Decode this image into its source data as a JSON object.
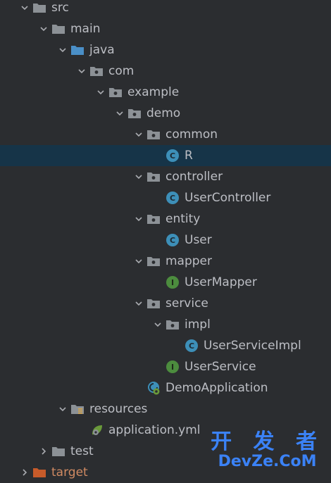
{
  "tree": [
    {
      "label": "src",
      "depth": 0,
      "kind": "folder",
      "arrow": "down",
      "icon": "folder-icon"
    },
    {
      "label": "main",
      "depth": 1,
      "kind": "folder",
      "arrow": "down",
      "icon": "folder-icon"
    },
    {
      "label": "java",
      "depth": 2,
      "kind": "folder",
      "arrow": "down",
      "icon": "source-folder-icon"
    },
    {
      "label": "com",
      "depth": 3,
      "kind": "package",
      "arrow": "down",
      "icon": "package-icon"
    },
    {
      "label": "example",
      "depth": 4,
      "kind": "package",
      "arrow": "down",
      "icon": "package-icon"
    },
    {
      "label": "demo",
      "depth": 5,
      "kind": "package",
      "arrow": "down",
      "icon": "package-icon"
    },
    {
      "label": "common",
      "depth": 6,
      "kind": "package",
      "arrow": "down",
      "icon": "package-icon"
    },
    {
      "label": "R",
      "depth": 7,
      "kind": "class",
      "arrow": "none",
      "icon": "class-icon",
      "selected": true
    },
    {
      "label": "controller",
      "depth": 6,
      "kind": "package",
      "arrow": "down",
      "icon": "package-icon"
    },
    {
      "label": "UserController",
      "depth": 7,
      "kind": "class",
      "arrow": "none",
      "icon": "class-icon"
    },
    {
      "label": "entity",
      "depth": 6,
      "kind": "package",
      "arrow": "down",
      "icon": "package-icon"
    },
    {
      "label": "User",
      "depth": 7,
      "kind": "class",
      "arrow": "none",
      "icon": "class-icon"
    },
    {
      "label": "mapper",
      "depth": 6,
      "kind": "package",
      "arrow": "down",
      "icon": "package-icon"
    },
    {
      "label": "UserMapper",
      "depth": 7,
      "kind": "interface",
      "arrow": "none",
      "icon": "interface-icon"
    },
    {
      "label": "service",
      "depth": 6,
      "kind": "package",
      "arrow": "down",
      "icon": "package-icon"
    },
    {
      "label": "impl",
      "depth": 7,
      "kind": "package",
      "arrow": "down",
      "icon": "package-icon"
    },
    {
      "label": "UserServiceImpl",
      "depth": 8,
      "kind": "class",
      "arrow": "none",
      "icon": "class-icon"
    },
    {
      "label": "UserService",
      "depth": 7,
      "kind": "interface",
      "arrow": "none",
      "icon": "interface-icon"
    },
    {
      "label": "DemoApplication",
      "depth": 6,
      "kind": "app",
      "arrow": "none",
      "icon": "spring-boot-app-icon"
    },
    {
      "label": "resources",
      "depth": 2,
      "kind": "resources",
      "arrow": "down",
      "icon": "resources-folder-icon"
    },
    {
      "label": "application.yml",
      "depth": 3,
      "kind": "yml",
      "arrow": "none",
      "icon": "spring-config-icon"
    },
    {
      "label": "test",
      "depth": 1,
      "kind": "folder",
      "arrow": "right",
      "icon": "folder-icon"
    },
    {
      "label": "target",
      "depth": 0,
      "kind": "excluded",
      "arrow": "right",
      "icon": "excluded-folder-icon"
    }
  ],
  "watermark": {
    "line1": "开 发 者",
    "line2": "DevZe.CoM"
  },
  "colors": {
    "background": "#2b2d30",
    "selected": "#163448",
    "text": "#bcbec4",
    "folder": "#8c9196",
    "source_folder": "#4a8fc7",
    "class": "#3d8fb8",
    "interface": "#4c8c3e",
    "excluded": "#c75b2a",
    "watermark": "#3b82f6"
  }
}
